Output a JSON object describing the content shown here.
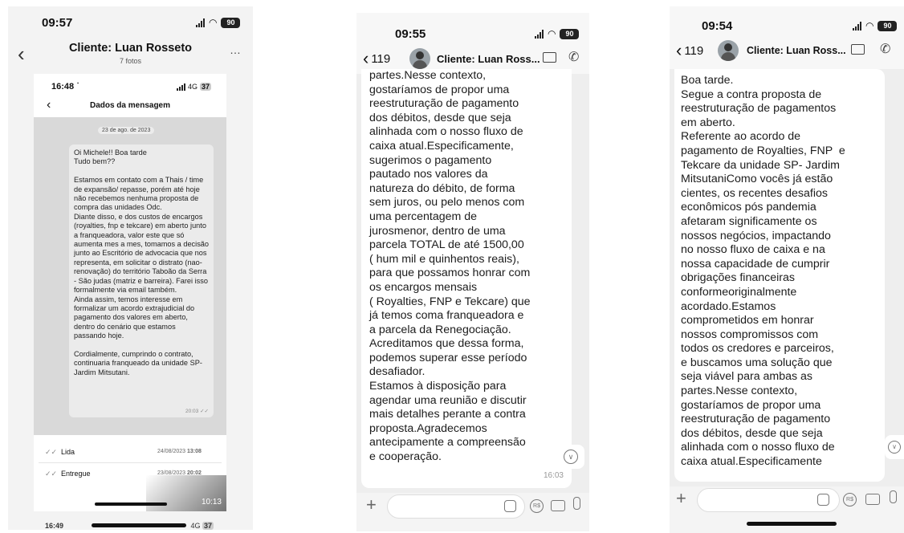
{
  "left": {
    "time": "09:57",
    "battery": "90",
    "title": "Cliente: Luan Rosseto",
    "subtitle": "7 fotos",
    "inner_time": "16:48",
    "inner_network": "4G",
    "inner_battery": "37",
    "inner_title": "Dados da mensagem",
    "date_chip": "23 de ago. de 2023",
    "message": "Oi Michele!! Boa tarde\nTudo bem??\n\nEstamos em contato com a Thais / time de expansão/ repasse, porém até hoje não recebemos nenhuma proposta de compra das unidades Odc.\nDiante disso, e dos custos de encargos (royalties, fnp e tekcare) em aberto junto a franqueadora, valor este que só aumenta mes a mes, tomamos a decisão junto ao Escritório de advocacia que nos representa, em solicitar o distrato (nao- renovação) do território Taboão da Serra - São judas (matriz e barreira). Farei isso formalmente via email também.\nAinda assim, temos interesse em formalizar um acordo extrajudicial do pagamento dos valores em aberto, dentro do cenário que estamos passando hoje.\n\nCordialmente, cumprindo o contrato, continuaria franqueado da unidade SP- Jardim Mitsutani.",
    "message_time": "20:03",
    "read_label": "Lida",
    "read_date": "24/08/2023",
    "read_time": "13:08",
    "delivered_label": "Entregue",
    "delivered_date": "23/08/2023",
    "delivered_time": "20:02",
    "video_time": "10:13",
    "bottom_time": "16:49",
    "bottom_network": "4G",
    "bottom_battery": "37"
  },
  "middle": {
    "time": "09:55",
    "battery": "90",
    "back_count": "119",
    "title": "Cliente: Luan Ross...",
    "message": "partes.Nesse contexto,\ngostaríamos de propor uma\nreestruturação de pagamento\ndos débitos, desde que seja\nalinhada com o nosso fluxo de\ncaixa atual.Especificamente,\nsugerimos o pagamento\npautado nos valores da\nnatureza do débito, de forma\nsem juros, ou pelo menos com\numa percentagem de\njurosmenor, dentro de uma\nparcela TOTAL de até 1500,00\n( hum mil e quinhentos reais),\npara que possamos honrar com\nos encargos mensais\n( Royalties, FNP e Tekcare) que\njá temos coma franqueadora e\na parcela da Renegociação.\nAcreditamos que dessa forma,\npodemos superar esse período\ndesafiador.\nEstamos à disposição para\nagendar uma reunião e discutir\nmais detalhes perante a contra\nproposta.Agradecemos\nantecipamente a compreensão\ne cooperação.",
    "message_time": "16:03"
  },
  "right": {
    "time": "09:54",
    "battery": "90",
    "back_count": "119",
    "title": "Cliente: Luan Ross...",
    "message": "Boa tarde.\nSegue a contra proposta de\nreestruturação de pagamentos\nem aberto.\nReferente ao acordo de\npagamento de Royalties, FNP  e\nTekcare da unidade SP- Jardim\nMitsutaniComo vocês já estão\ncientes, os recentes desafios\neconômicos pós pandemia\nafetaram significamente os\nnossos negócios, impactando\nno nosso fluxo de caixa e na\nnossa capacidade de cumprir\nobrigações financeiras\nconformeoriginalmente\nacordado.Estamos\ncomprometidos em honrar\nnossos compromissos com\ntodos os credores e parceiros,\ne buscamos uma solução que\nseja viável para ambas as\npartes.Nesse contexto,\ngostaríamos de propor uma\nreestruturação de pagamento\ndos débitos, desde que seja\nalinhada com o nosso fluxo de\ncaixa atual.Especificamente"
  }
}
